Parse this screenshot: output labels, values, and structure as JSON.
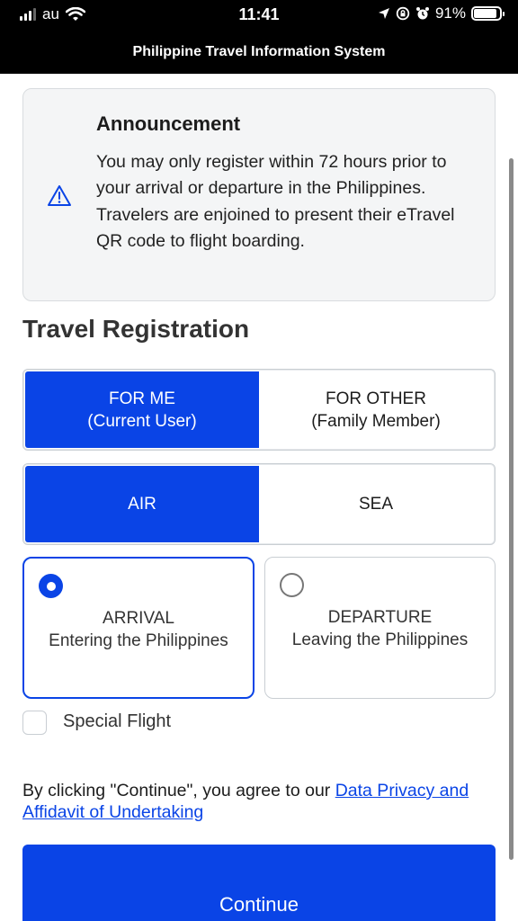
{
  "status_bar": {
    "carrier": "au",
    "time": "11:41",
    "battery": "91%",
    "battery_level": 0.91,
    "icons": [
      "signal-icon",
      "wifi-icon",
      "location-arrow-icon",
      "orientation-lock-icon",
      "alarm-icon",
      "battery-icon"
    ]
  },
  "header": {
    "title": "Philippine Travel Information System"
  },
  "announcement": {
    "icon": "warning-triangle-icon",
    "title": "Announcement",
    "body": "You may only register within 72 hours prior to your arrival or departure in the Philippines. Travelers are enjoined to present their eTravel QR code to flight boarding."
  },
  "form": {
    "title": "Travel Registration",
    "traveler_type": [
      {
        "line1": "FOR ME",
        "line2": "(Current User)",
        "selected": true
      },
      {
        "line1": "FOR OTHER",
        "line2": "(Family Member)",
        "selected": false
      }
    ],
    "travel_mode": [
      {
        "label": "AIR",
        "selected": true
      },
      {
        "label": "SEA",
        "selected": false
      }
    ],
    "direction": [
      {
        "title": "ARRIVAL",
        "subtitle": "Entering the Philippines",
        "selected": true
      },
      {
        "title": "DEPARTURE",
        "subtitle": "Leaving the Philippines",
        "selected": false
      }
    ],
    "special_flight": {
      "label": "Special Flight",
      "checked": false
    }
  },
  "consent": {
    "prefix": "By clicking \"Continue\", you agree to our ",
    "link": "Data Privacy and Affidavit of Undertaking"
  },
  "continue_button": {
    "label": "Continue"
  },
  "colors": {
    "primary": "#0a44e6",
    "panel_bg": "#f4f5f6",
    "header_bg": "#000000"
  }
}
